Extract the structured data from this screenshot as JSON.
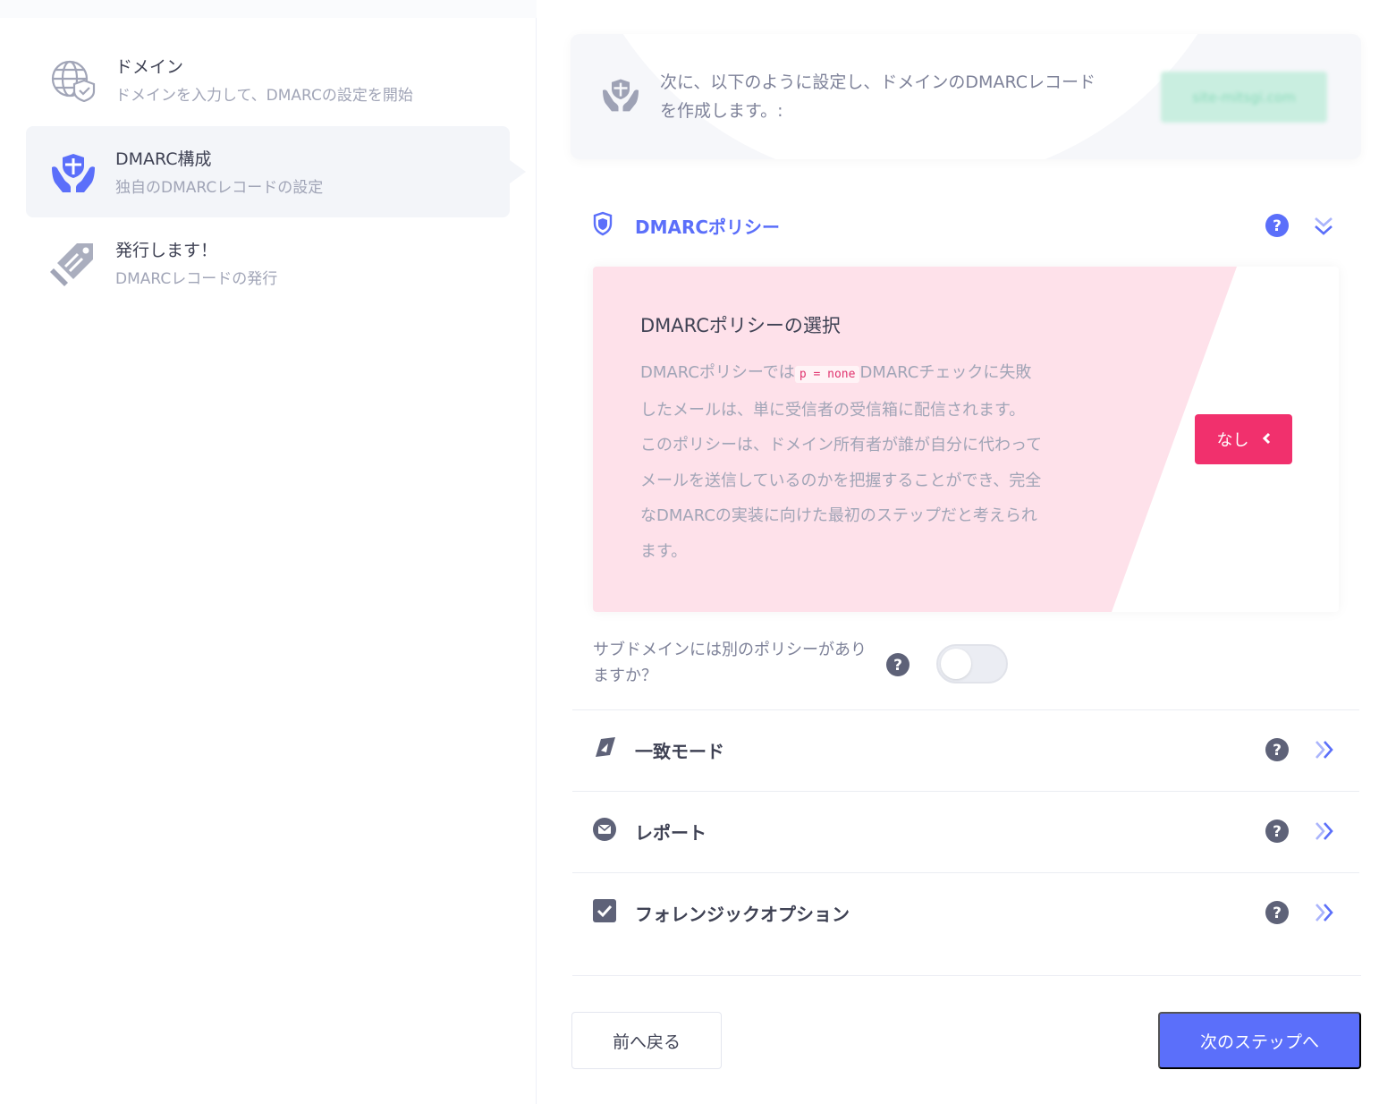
{
  "sidebar": {
    "steps": [
      {
        "title": "ドメイン",
        "subtitle": "ドメインを入力して、DMARCの設定を開始",
        "icon": "globe-shield-icon",
        "active": false
      },
      {
        "title": "DMARC構成",
        "subtitle": "独自のDMARCレコードの設定",
        "icon": "hands-shield-icon",
        "active": true
      },
      {
        "title": "発行します！",
        "subtitle": "DMARCレコードの発行",
        "icon": "publish-tag-icon",
        "active": false
      }
    ]
  },
  "notice": {
    "text": "次に、以下のように設定し、ドメインのDMARCレコードを作成します。:",
    "domain": "site-mitsgi.com",
    "icon": "hands-shield-icon"
  },
  "sections": {
    "policy": {
      "title": "DMARCポリシー",
      "icon": "shield-icon",
      "expanded": true
    },
    "alignment": {
      "title": "一致モード",
      "icon": "compass-icon"
    },
    "reports": {
      "title": "レポート",
      "icon": "envelope-icon"
    },
    "forensic": {
      "title": "フォレンジックオプション",
      "icon": "checkbox-icon"
    }
  },
  "policy_card": {
    "title": "DMARCポリシーの選択",
    "desc_before": "DMARCポリシーでは",
    "code": "p = none",
    "desc_after": "DMARCチェックに失敗したメールは、単に受信者の受信箱に配信されます。 このポリシーは、ドメイン所有者が誰が自分に代わってメールを送信しているのかを把握することができ、完全なDMARCの実装に向けた最初のステップだと考えられます。",
    "selected_label": "なし"
  },
  "subdomain": {
    "question": "サブドメインには別のポリシーがありますか？",
    "toggle_on": false
  },
  "buttons": {
    "back": "前へ戻る",
    "next": "次のステップへ"
  },
  "colors": {
    "accent": "#5b6ffa",
    "policy_pink": "#fee1ea",
    "none_button": "#f1306d",
    "icon_dark": "#5e6278"
  }
}
